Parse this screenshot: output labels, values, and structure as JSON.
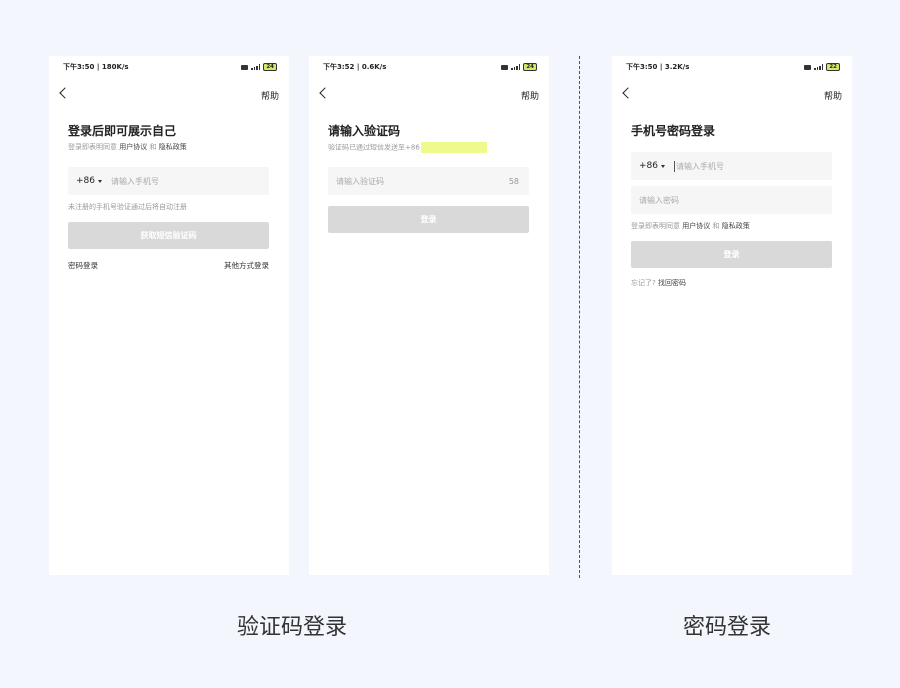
{
  "screens": [
    {
      "status": {
        "time": "下午3:50 | 180K/s",
        "battery": "24"
      },
      "help": "帮助",
      "title": "登录后即可展示自己",
      "agreement": {
        "prefix": "登录即表明同意",
        "user": "用户协议",
        "and": "和",
        "privacy": "隐私政策"
      },
      "country_code": "+86",
      "phone_placeholder": "请输入手机号",
      "note": "未注册的手机号验证通过后将自动注册",
      "button": "获取短信验证码",
      "password_login": "密码登录",
      "other_login": "其他方式登录"
    },
    {
      "status": {
        "time": "下午3:52 | 0.6K/s",
        "battery": "24"
      },
      "help": "帮助",
      "title": "请输入验证码",
      "sent_text": "验证码已通过短信发送至+86",
      "code_placeholder": "请输入验证码",
      "countdown": "58",
      "button": "登录"
    },
    {
      "status": {
        "time": "下午3:50 | 3.2K/s",
        "battery": "22"
      },
      "help": "帮助",
      "title": "手机号密码登录",
      "country_code": "+86",
      "phone_placeholder": "请输入手机号",
      "password_placeholder": "请输入密码",
      "agreement": {
        "prefix": "登录即表明同意",
        "user": "用户协议",
        "and": "和",
        "privacy": "隐私政策"
      },
      "button": "登录",
      "forgot_prefix": "忘记了?",
      "forgot_link": "找回密码"
    }
  ],
  "captions": {
    "sms": "验证码登录",
    "password": "密码登录"
  },
  "colors": {
    "background": "#f3f6fc",
    "button_disabled": "#d9d9d9",
    "highlight": "#eefb8c"
  }
}
